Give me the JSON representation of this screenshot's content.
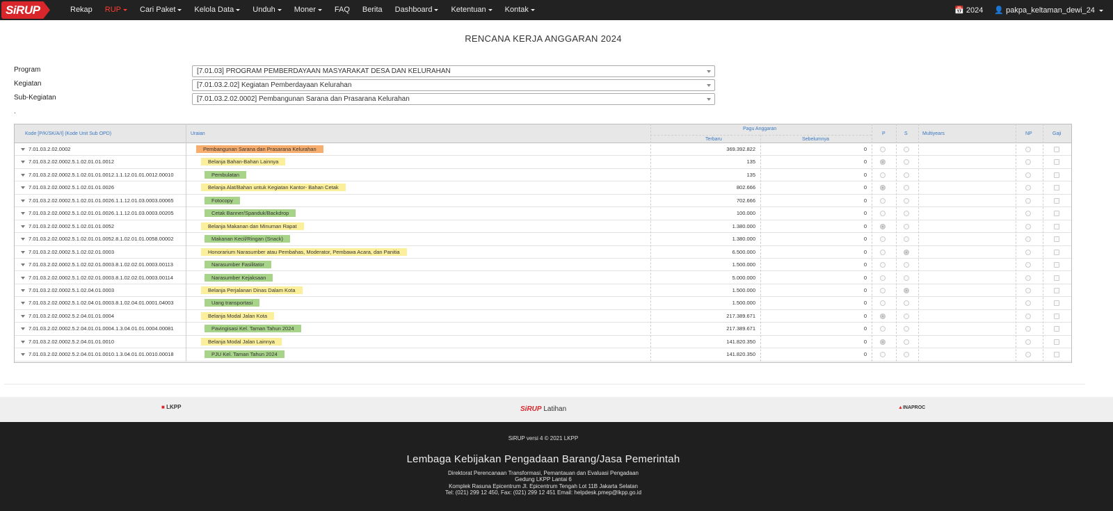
{
  "navbar": {
    "brand": "SiRUP",
    "items": [
      {
        "label": "Rekap",
        "dropdown": false,
        "active": false
      },
      {
        "label": "RUP",
        "dropdown": true,
        "active": true
      },
      {
        "label": "Cari Paket",
        "dropdown": true,
        "active": false
      },
      {
        "label": "Kelola Data",
        "dropdown": true,
        "active": false
      },
      {
        "label": "Unduh",
        "dropdown": true,
        "active": false
      },
      {
        "label": "Moner",
        "dropdown": true,
        "active": false
      },
      {
        "label": "FAQ",
        "dropdown": false,
        "active": false
      },
      {
        "label": "Berita",
        "dropdown": false,
        "active": false
      },
      {
        "label": "Dashboard",
        "dropdown": true,
        "active": false
      },
      {
        "label": "Ketentuan",
        "dropdown": true,
        "active": false
      },
      {
        "label": "Kontak",
        "dropdown": true,
        "active": false
      }
    ],
    "year": "2024",
    "user": "pakpa_keltaman_dewi_24",
    "accent_color": "#ff3b30"
  },
  "page": {
    "title": "RENCANA KERJA ANGGARAN 2024"
  },
  "filters": {
    "program_label": "Program",
    "program_value": "[7.01.03] PROGRAM PEMBERDAYAAN MASYARAKAT DESA DAN KELURAHAN",
    "kegiatan_label": "Kegiatan",
    "kegiatan_value": "[7.01.03.2.02] Kegiatan Pemberdayaan Kelurahan",
    "subkegiatan_label": "Sub-Kegiatan",
    "subkegiatan_value": "[7.01.03.2.02.0002] Pembangunan Sarana dan Prasarana Kelurahan",
    "dot": "."
  },
  "table": {
    "headers": {
      "kode": "Kode [P/K/SK/A/I] (Kode Unit Sub OPD)",
      "uraian": "Uraian",
      "pagu": "Pagu Anggaran",
      "terbaru": "Terbaru",
      "sebelumnya": "Sebelumnya",
      "p": "P",
      "s": "S",
      "multiyears": "Multiyears",
      "np": "NP",
      "gaji": "Gaji"
    },
    "rows": [
      {
        "kode": "7.01.03.2.02.0002",
        "uraian": "Pembangunan Sarana dan Prasarana Kelurahan",
        "level": 0,
        "terbaru": "369.392.822",
        "sebelumnya": "0",
        "p": false,
        "s": false
      },
      {
        "kode": "7.01.03.2.02.0002.5.1.02.01.01.0012",
        "uraian": "Belanja Bahan-Bahan Lainnya",
        "level": 1,
        "terbaru": "135",
        "sebelumnya": "0",
        "p": true,
        "s": false
      },
      {
        "kode": "7.01.03.2.02.0002.5.1.02.01.01.0012.1.1.12.01.01.0012.00010",
        "uraian": "Pembulatan",
        "level": 2,
        "terbaru": "135",
        "sebelumnya": "0",
        "p": false,
        "s": false
      },
      {
        "kode": "7.01.03.2.02.0002.5.1.02.01.01.0026",
        "uraian": "Belanja Alat/Bahan untuk Kegiatan Kantor- Bahan Cetak",
        "level": 1,
        "terbaru": "802.666",
        "sebelumnya": "0",
        "p": true,
        "s": false
      },
      {
        "kode": "7.01.03.2.02.0002.5.1.02.01.01.0026.1.1.12.01.03.0003.00065",
        "uraian": "Fotocopy",
        "level": 2,
        "terbaru": "702.666",
        "sebelumnya": "0",
        "p": false,
        "s": false
      },
      {
        "kode": "7.01.03.2.02.0002.5.1.02.01.01.0026.1.1.12.01.03.0003.00205",
        "uraian": "Cetak Banner/Spanduk/Backdrop",
        "level": 2,
        "terbaru": "100.000",
        "sebelumnya": "0",
        "p": false,
        "s": false
      },
      {
        "kode": "7.01.03.2.02.0002.5.1.02.01.01.0052",
        "uraian": "Belanja Makanan dan Minuman Rapat",
        "level": 1,
        "terbaru": "1.380.000",
        "sebelumnya": "0",
        "p": true,
        "s": false
      },
      {
        "kode": "7.01.03.2.02.0002.5.1.02.01.01.0052.8.1.02.01.01.0058.00002",
        "uraian": "Makanan Kecil/Ringan (Snack)",
        "level": 2,
        "terbaru": "1.380.000",
        "sebelumnya": "0",
        "p": false,
        "s": false
      },
      {
        "kode": "7.01.03.2.02.0002.5.1.02.02.01.0003",
        "uraian": "Honorarium Narasumber atau Pembahas, Moderator, Pembawa Acara, dan Panitia",
        "level": 1,
        "terbaru": "6.500.000",
        "sebelumnya": "0",
        "p": false,
        "s": true
      },
      {
        "kode": "7.01.03.2.02.0002.5.1.02.02.01.0003.8.1.02.02.01.0003.00113",
        "uraian": "Narasumber Fasilitator",
        "level": 2,
        "terbaru": "1.500.000",
        "sebelumnya": "0",
        "p": false,
        "s": false
      },
      {
        "kode": "7.01.03.2.02.0002.5.1.02.02.01.0003.8.1.02.02.01.0003.00114",
        "uraian": "Narasumber Kejaksaan",
        "level": 2,
        "terbaru": "5.000.000",
        "sebelumnya": "0",
        "p": false,
        "s": false
      },
      {
        "kode": "7.01.03.2.02.0002.5.1.02.04.01.0003",
        "uraian": "Belanja Perjalanan Dinas Dalam Kota",
        "level": 1,
        "terbaru": "1.500.000",
        "sebelumnya": "0",
        "p": false,
        "s": true
      },
      {
        "kode": "7.01.03.2.02.0002.5.1.02.04.01.0003.8.1.02.04.01.0001.04003",
        "uraian": "Uang transportasi",
        "level": 2,
        "terbaru": "1.500.000",
        "sebelumnya": "0",
        "p": false,
        "s": false
      },
      {
        "kode": "7.01.03.2.02.0002.5.2.04.01.01.0004",
        "uraian": "Belanja Modal Jalan Kota",
        "level": 1,
        "terbaru": "217.389.671",
        "sebelumnya": "0",
        "p": true,
        "s": false
      },
      {
        "kode": "7.01.03.2.02.0002.5.2.04.01.01.0004.1.3.04.01.01.0004.00081",
        "uraian": "Pavingisasi Kel. Taman Tahun 2024",
        "level": 2,
        "terbaru": "217.389.671",
        "sebelumnya": "0",
        "p": false,
        "s": false
      },
      {
        "kode": "7.01.03.2.02.0002.5.2.04.01.01.0010",
        "uraian": "Belanja Modal Jalan Lainnya",
        "level": 1,
        "terbaru": "141.820.350",
        "sebelumnya": "0",
        "p": true,
        "s": false
      },
      {
        "kode": "7.01.03.2.02.0002.5.2.04.01.01.0010.1.3.04.01.01.0010.00018",
        "uraian": "PJU Kel. Taman Tahun 2024",
        "level": 2,
        "terbaru": "141.820.350",
        "sebelumnya": "0",
        "p": false,
        "s": false
      }
    ],
    "level_colors": [
      "#f7ad6d",
      "#fbef9b",
      "#a8d489"
    ]
  },
  "footer": {
    "lkpp_logo": "LKPP",
    "sirup_brand": "SiRUP",
    "sirup_suffix": "Latihan",
    "inaproc": "INAPROC",
    "version": "SiRUP versi 4 © 2021 LKPP",
    "org": "Lembaga Kebijakan Pengadaan Barang/Jasa Pemerintah",
    "line1": "Direktorat Perencanaan Transformasi, Pemantauan dan Evaluasi Pengadaan",
    "line2": "Gedung LKPP Lantai 6",
    "line3": "Komplek Rasuna Epicentrum Jl. Epicentrum Tengah Lot 11B Jakarta Selatan",
    "line4": "Tel: (021) 299 12 450, Fax: (021) 299 12 451 Email: helpdesk.pmep@lkpp.go.id"
  }
}
